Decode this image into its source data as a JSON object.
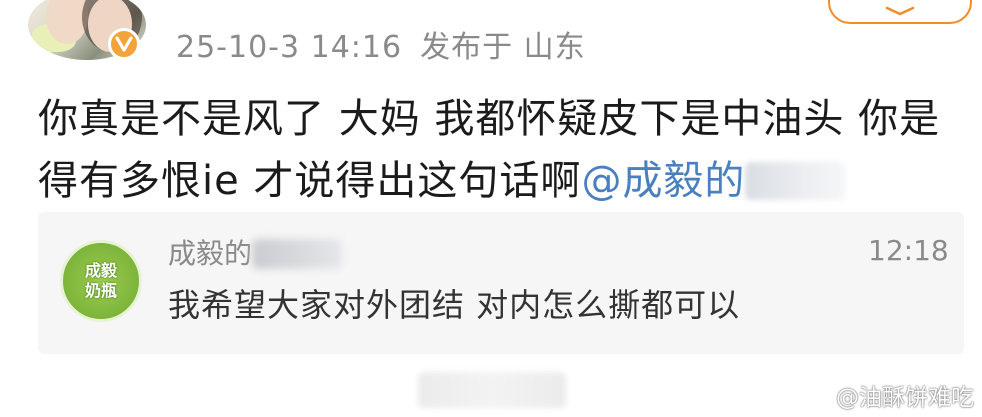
{
  "post": {
    "timestamp": "25-10-3 14:16",
    "location": "发布于 山东",
    "text_line1": "你真是不是风了 大妈 我都怀疑皮下是中油头 你是",
    "text_line2": "得有多恨ie 才说得出这句话啊",
    "mention": "@成毅的"
  },
  "reply": {
    "username": "成毅的",
    "avatar_text_top": "成毅",
    "avatar_text_bottom": "奶瓶",
    "time": "12:18",
    "text": "我希望大家对外团结 对内怎么撕都可以"
  },
  "watermark": {
    "text": "@油酥饼难吃"
  },
  "colors": {
    "mention": "#4a7fc0",
    "meta_gray": "#8a8a8a",
    "verified_orange": "#f2a33a",
    "card_bg": "#f6f6f6",
    "reply_avatar_green": "#7cb53a"
  },
  "icons": {
    "verified": "verified-v-icon",
    "watermark_logo": "weibo-logo-icon"
  }
}
